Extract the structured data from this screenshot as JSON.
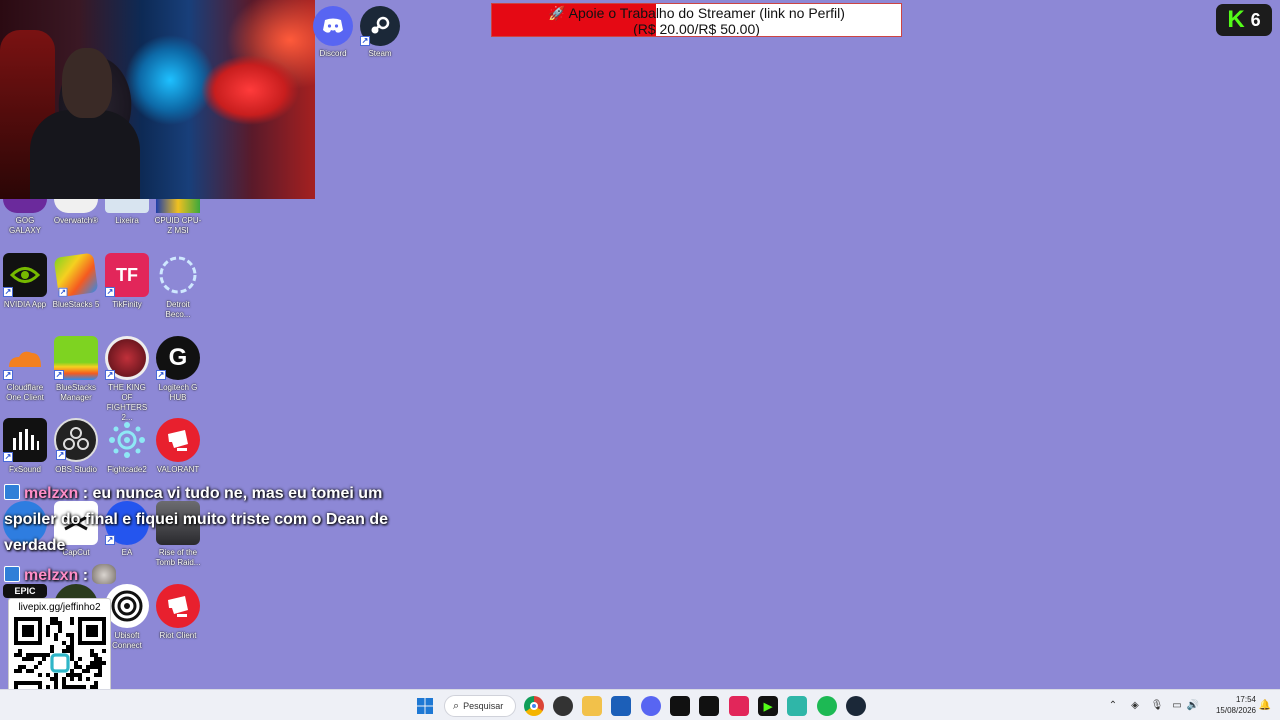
{
  "banner": {
    "line1": "🚀 Apoie o Trabalho do Streamer (link no Perfil)",
    "line2": "(R$ 20.00/R$ 50.00)",
    "progress_fraction": 0.4
  },
  "k6": {
    "letter": "K",
    "number": "6"
  },
  "top_icons": [
    {
      "label": "Discord"
    },
    {
      "label": "Steam"
    }
  ],
  "desktop_icons": [
    {
      "label": "GOG GALAXY"
    },
    {
      "label": "Overwatch®"
    },
    {
      "label": "Lixeira"
    },
    {
      "label": "CPUID CPU-Z MSI"
    },
    {
      "label": "NVIDIA App"
    },
    {
      "label": "BlueStacks 5"
    },
    {
      "label": "TikFinity"
    },
    {
      "label": "Detroit Beco..."
    },
    {
      "label": "Cloudflare One Client"
    },
    {
      "label": "BlueStacks Manager"
    },
    {
      "label": "THE KING OF FIGHTERS 2..."
    },
    {
      "label": "Logitech G HUB"
    },
    {
      "label": "FxSound"
    },
    {
      "label": "OBS Studio"
    },
    {
      "label": "Fightcade2"
    },
    {
      "label": "VALORANT"
    },
    {
      "label": "CapCut"
    },
    {
      "label": "EA"
    },
    {
      "label": "Rise of the Tomb Raid..."
    },
    {
      "label": "Ubisoft Connect"
    },
    {
      "label": "Riot Client"
    }
  ],
  "chat": [
    {
      "user": "melzxn",
      "message": "eu nunca vi tudo ne, mas eu tomei um spoiler do final e fiquei muito triste com o Dean de verdade"
    },
    {
      "user": "melzxn",
      "message": ""
    }
  ],
  "qr": {
    "url": "livepix.gg/jeffinho2"
  },
  "taskbar": {
    "search_label": "Pesquisar",
    "time": "17:54",
    "date": "15/08/2026"
  },
  "colors": {
    "desktop": "#8d88d6",
    "banner_fill": "#e50914",
    "kick_green": "#53fc18",
    "chat_user": "#ff8ec8"
  }
}
